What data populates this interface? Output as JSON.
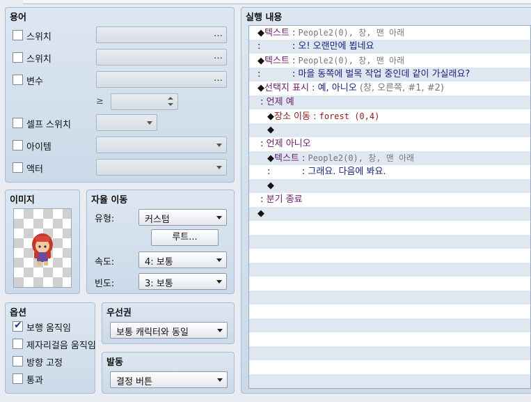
{
  "conditions": {
    "title": "용어",
    "switch1_label": "스위치",
    "switch2_label": "스위치",
    "variable_label": "변수",
    "ge_symbol": "≥",
    "self_switch_label": "셀프 스위치",
    "item_label": "아이템",
    "actor_label": "액터",
    "ellipsis": "…"
  },
  "image": {
    "title": "이미지"
  },
  "autonomous": {
    "title": "자율 이동",
    "type_label": "유형:",
    "type_value": "커스텀",
    "route_button": "루트...",
    "speed_label": "속도:",
    "speed_value": "4: 보통",
    "freq_label": "빈도:",
    "freq_value": "3: 보통"
  },
  "options": {
    "title": "옵션",
    "walking": {
      "label": "보행 움직임",
      "checked": true
    },
    "stepping": {
      "label": "제자리걸음 움직임",
      "checked": false
    },
    "direction_fix": {
      "label": "방향 고정",
      "checked": false
    },
    "through": {
      "label": "통과",
      "checked": false
    }
  },
  "priority": {
    "title": "우선권",
    "value": "보통 캐릭터와 동일"
  },
  "trigger": {
    "title": "발동",
    "value": "결정 버튼"
  },
  "contents": {
    "title": "실행 내용",
    "lines": [
      {
        "indent": 0,
        "parts": [
          {
            "t": "◆",
            "c": "c-black"
          },
          {
            "t": "텍스트 : ",
            "c": "c-purple"
          },
          {
            "t": "People2(0), 창, 맨 아래",
            "c": "c-gray"
          }
        ]
      },
      {
        "indent": 0,
        "parts": [
          {
            "t": ":           : ",
            "c": "c-black"
          },
          {
            "t": "오! 오랜만에 뵙네요",
            "c": "c-navy"
          }
        ]
      },
      {
        "indent": 0,
        "parts": [
          {
            "t": "◆",
            "c": "c-black"
          },
          {
            "t": "텍스트 : ",
            "c": "c-purple"
          },
          {
            "t": "People2(0), 창, 맨 아래",
            "c": "c-gray"
          }
        ]
      },
      {
        "indent": 0,
        "parts": [
          {
            "t": ":           : ",
            "c": "c-black"
          },
          {
            "t": "마을 동쪽에 벌목 작업 중인데 같이 가실래요?",
            "c": "c-navy"
          }
        ]
      },
      {
        "indent": 0,
        "parts": [
          {
            "t": "◆",
            "c": "c-black"
          },
          {
            "t": "선택지 표시 : ",
            "c": "c-purple"
          },
          {
            "t": "예, 아니오",
            "c": "c-navy"
          },
          {
            "t": " (창, 오른쪽, #1, #2)",
            "c": "c-gray"
          }
        ]
      },
      {
        "indent": 0,
        "parts": [
          {
            "t": " : ",
            "c": "c-black"
          },
          {
            "t": "언제 예",
            "c": "c-purple"
          }
        ]
      },
      {
        "indent": 1,
        "parts": [
          {
            "t": "◆",
            "c": "c-black"
          },
          {
            "t": "장소 이동 : ",
            "c": "c-maroon"
          },
          {
            "t": "forest (0,4)",
            "c": "c-maroon"
          }
        ]
      },
      {
        "indent": 1,
        "parts": [
          {
            "t": "◆",
            "c": "c-black"
          }
        ]
      },
      {
        "indent": 0,
        "parts": [
          {
            "t": " : ",
            "c": "c-black"
          },
          {
            "t": "언제 아니오",
            "c": "c-purple"
          }
        ]
      },
      {
        "indent": 1,
        "parts": [
          {
            "t": "◆",
            "c": "c-black"
          },
          {
            "t": "텍스트 : ",
            "c": "c-purple"
          },
          {
            "t": "People2(0), 창, 맨 아래",
            "c": "c-gray"
          }
        ]
      },
      {
        "indent": 1,
        "parts": [
          {
            "t": ":           : ",
            "c": "c-black"
          },
          {
            "t": "그래요. 다음에 봐요.",
            "c": "c-navy"
          }
        ]
      },
      {
        "indent": 1,
        "parts": [
          {
            "t": "◆",
            "c": "c-black"
          }
        ]
      },
      {
        "indent": 0,
        "parts": [
          {
            "t": " : ",
            "c": "c-black"
          },
          {
            "t": "분기 종료",
            "c": "c-purple"
          }
        ]
      },
      {
        "indent": 0,
        "parts": [
          {
            "t": "◆",
            "c": "c-black"
          }
        ]
      }
    ]
  }
}
